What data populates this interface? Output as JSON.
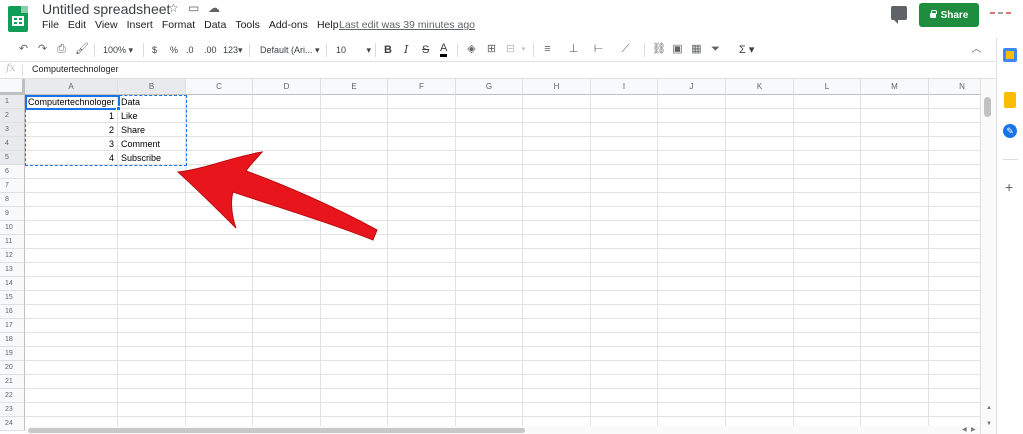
{
  "app": {
    "title": "Untitled spreadsheet",
    "menu": [
      "File",
      "Edit",
      "View",
      "Insert",
      "Format",
      "Data",
      "Tools",
      "Add-ons",
      "Help"
    ],
    "last_edit": "Last edit was 39 minutes ago",
    "share_label": "Share"
  },
  "toolbar": {
    "zoom": "100%",
    "currency": "$",
    "percent": "%",
    "decimal_decrease": ".0",
    "decimal_increase": ".00",
    "more_formats": "123",
    "font": "Default (Ari...",
    "font_size": "10",
    "bold": "B",
    "italic": "I",
    "strikethrough": "S",
    "text_color": "A",
    "sum": "Σ"
  },
  "formula_bar": {
    "fx": "fx",
    "value": "Computertechnologer"
  },
  "grid": {
    "columns": [
      "A",
      "B",
      "C",
      "D",
      "E",
      "F",
      "G",
      "H",
      "I",
      "J",
      "K",
      "L",
      "M",
      "N"
    ],
    "rows": [
      "1",
      "2",
      "3",
      "4",
      "5",
      "6",
      "7",
      "8",
      "9",
      "10",
      "11",
      "12",
      "13",
      "14",
      "15",
      "16",
      "17",
      "18",
      "19",
      "20",
      "21",
      "22",
      "23",
      "24"
    ],
    "cells": {
      "A1": "Computertechnologer",
      "B1": "Data",
      "A2": "1",
      "B2": "Like",
      "A3": "2",
      "B3": "Share",
      "A4": "3",
      "B4": "Comment",
      "A5": "4",
      "B5": "Subscribe"
    }
  },
  "colors": {
    "share_button": "#1e8e3e",
    "selection": "#1a73e8",
    "annotation_arrow": "#e8161c"
  }
}
